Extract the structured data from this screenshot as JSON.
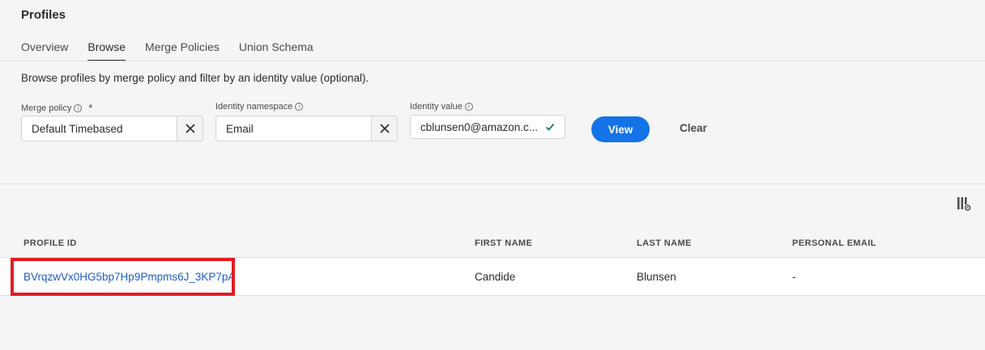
{
  "page": {
    "title": "Profiles"
  },
  "tabs": [
    {
      "label": "Overview",
      "active": false
    },
    {
      "label": "Browse",
      "active": true
    },
    {
      "label": "Merge Policies",
      "active": false
    },
    {
      "label": "Union Schema",
      "active": false
    }
  ],
  "intro_text": "Browse profiles by merge policy and filter by an identity value (optional).",
  "filters": {
    "merge_policy": {
      "label": "Merge policy",
      "value": "Default Timebased",
      "required": true
    },
    "identity_namespace": {
      "label": "Identity namespace",
      "value": "Email"
    },
    "identity_value": {
      "label": "Identity value",
      "value": "cblunsen0@amazon.c..."
    }
  },
  "actions": {
    "view_label": "View",
    "clear_label": "Clear"
  },
  "table": {
    "columns": [
      "PROFILE ID",
      "FIRST NAME",
      "LAST NAME",
      "PERSONAL EMAIL"
    ],
    "rows": [
      {
        "profile_id": "BVrqzwVx0HG5bp7Hp9Pmpms6J_3KP7pA",
        "first_name": "Candide",
        "last_name": "Blunsen",
        "personal_email": "-"
      }
    ]
  },
  "colors": {
    "accent": "#1473e6",
    "link": "#1d5cc9",
    "highlight": "#e41b23"
  }
}
